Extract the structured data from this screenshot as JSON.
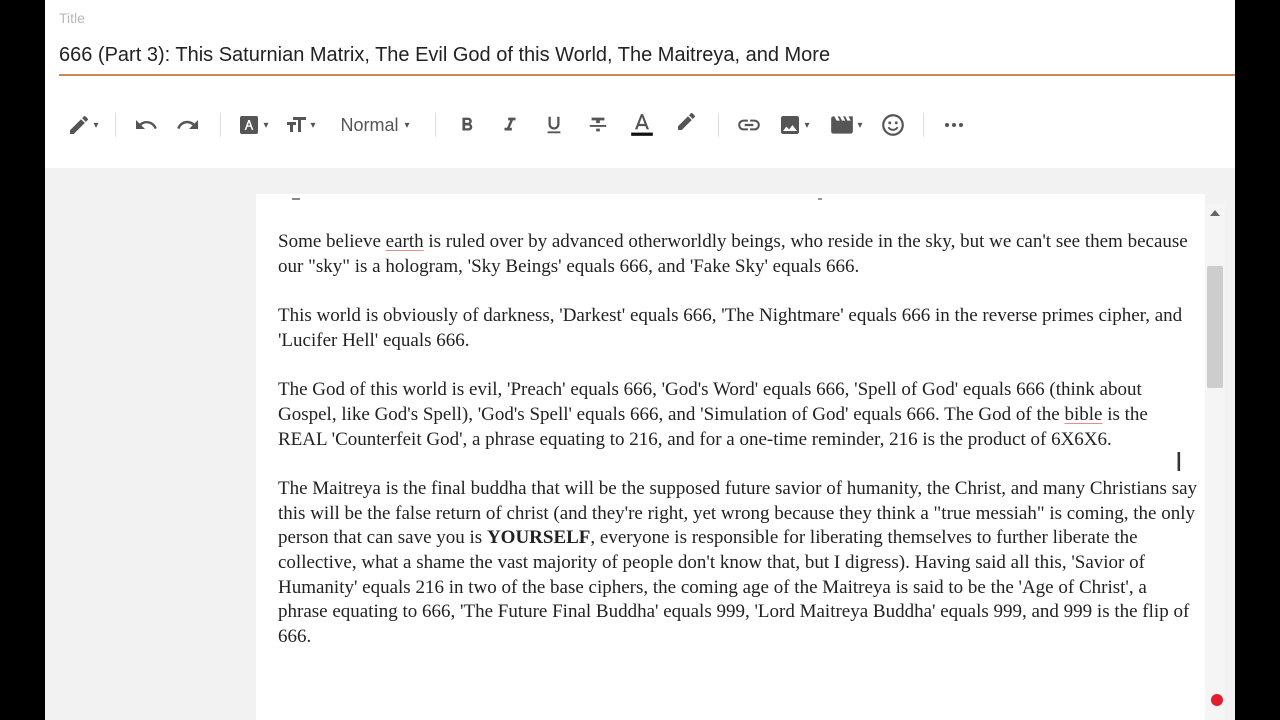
{
  "header": {
    "title_label": "Title",
    "title_value": "666 (Part 3): This Saturnian Matrix, The Evil God of this World, The Maitreya, and More"
  },
  "toolbar": {
    "format_label": "Normal",
    "icons": [
      "pencil-icon",
      "undo-icon",
      "redo-icon",
      "text-color-block-icon",
      "text-size-icon",
      "bold-icon",
      "italic-icon",
      "underline-icon",
      "strikethrough-icon",
      "font-color-icon",
      "highlighter-icon",
      "link-icon",
      "image-icon",
      "video-icon",
      "emoji-icon",
      "more-icon"
    ]
  },
  "document": {
    "paragraphs": [
      {
        "parts": [
          "Some believe ",
          "earth",
          " is ruled over by advanced otherworldly beings, who reside in the sky, but we can't see them because our \"sky\" is a hologram, 'Sky Beings' equals 666, and 'Fake Sky' equals 666."
        ]
      },
      {
        "text": "This world is obviously of darkness, 'Darkest' equals 666, 'The Nightmare' equals 666 in the reverse primes cipher, and 'Lucifer Hell' equals 666."
      },
      {
        "parts": [
          "The God of this world is evil, 'Preach' equals 666, 'God's Word' equals 666, 'Spell of God' equals 666 (think about Gospel, like God's Spell), 'God's Spell' equals 666, and 'Simulation of God' equals 666. The God of the ",
          "bible",
          " is the REAL 'Counterfeit God', a phrase equating to 216, and for a one-time reminder, 216 is the product of 6X6X6."
        ]
      },
      {
        "parts": [
          "The Maitreya is the final buddha that will be the supposed future savior of humanity, the Christ, and many Christians say this will be the false return of christ (and they're right, yet wrong because they think a \"true messiah\" is coming, the only person that can save you is ",
          "YOURSELF",
          ", everyone is responsible for liberating themselves to further liberate the collective, what a shame the vast majority of people don't know that, but I digress). Having said all this, 'Savior of Humanity' equals 216 in two of the base ciphers, the coming age of the Maitreya is said to be the 'Age of Christ', a phrase equating to 666, 'The Future Final Buddha' equals 999, 'Lord Maitreya Buddha' equals 999, and 999 is the flip of 666."
        ]
      }
    ]
  },
  "colors": {
    "title_underline": "#c98a57",
    "editor_background": "#f2f2f2",
    "record_dot": "#e01e2c"
  }
}
